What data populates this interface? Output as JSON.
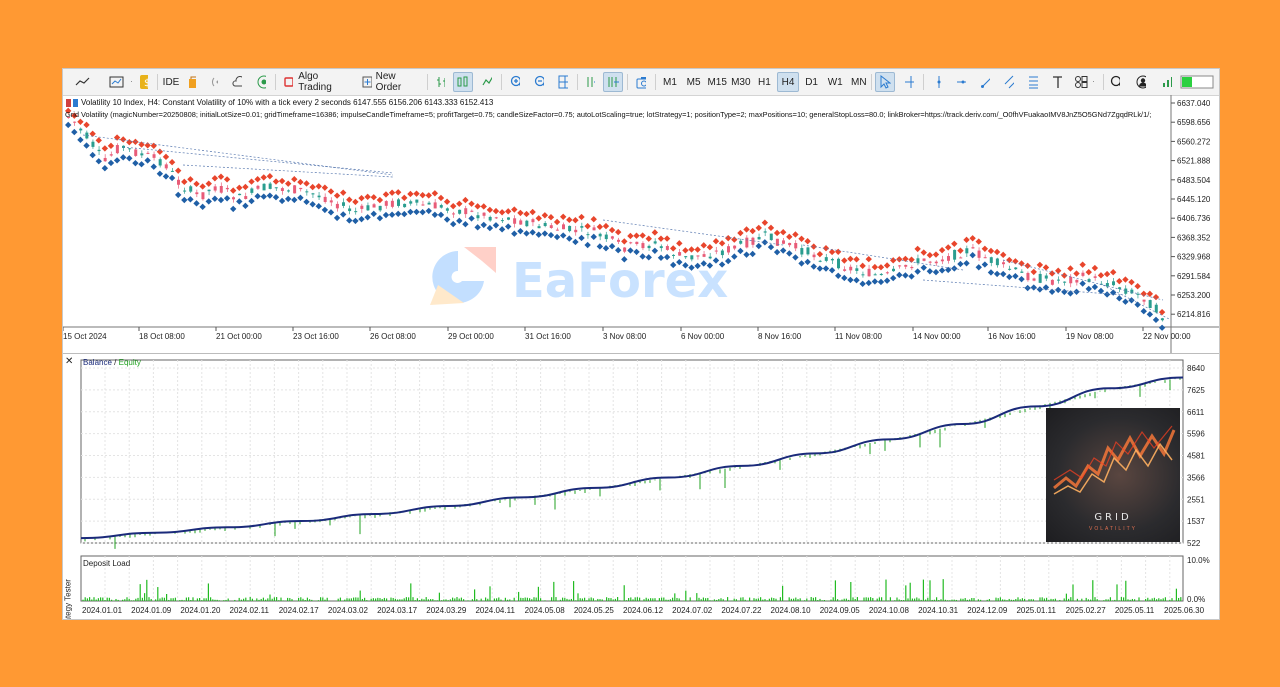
{
  "toolbar": {
    "ide_label": "IDE",
    "algo_trading_label": "Algo Trading",
    "new_order_label": "New Order",
    "timeframes": [
      "M1",
      "M5",
      "M15",
      "M30",
      "H1",
      "H4",
      "D1",
      "W1",
      "MN"
    ],
    "active_timeframe": "H4"
  },
  "chart": {
    "header": "Volatility 10 Index, H4:  Constant Volatility of 10% with a tick every 2 seconds  6147.555 6156.206 6143.333 6152.413",
    "params": "Grid Volatility (magicNumber=20250808; initialLotSize=0.01; gridTimeframe=16386; impulseCandleTimeframe=5; profitTarget=0.75; candleSizeFactor=0.75; autoLotScaling=true; lotStrategy=1; positionType=2; maxPositions=10; generalStopLoss=80.0; linkBroker=https://track.deriv.com/_O0fhVFuakaoIMV8JnZ5O5GNd7ZgqdRLk/1/;",
    "price_labels": [
      "6637.040",
      "6598.656",
      "6560.272",
      "6521.888",
      "6483.504",
      "6445.120",
      "6406.736",
      "6368.352",
      "6329.968",
      "6291.584",
      "6253.200",
      "6214.816"
    ],
    "date_labels": [
      "15 Oct 2024",
      "18 Oct 08:00",
      "21 Oct 00:00",
      "23 Oct 16:00",
      "26 Oct 08:00",
      "29 Oct 00:00",
      "31 Oct 16:00",
      "3 Nov 08:00",
      "6 Nov 00:00",
      "8 Nov 16:00",
      "11 Nov 08:00",
      "14 Nov 00:00",
      "16 Nov 16:00",
      "19 Nov 08:00",
      "22 Nov 00:00"
    ],
    "colors": {
      "bull": "#2a9d8f",
      "bear": "#e85c78",
      "sell_marker": "#e8452c",
      "buy_marker": "#1f5fa6"
    }
  },
  "chart_data": [
    {
      "type": "line",
      "series": [
        {
          "name": "Balance",
          "values": [
            750,
            1000,
            1250,
            1540,
            1870,
            2240,
            2640,
            3080,
            3560,
            4100,
            4680,
            5330,
            6040,
            6860,
            7700,
            8200
          ]
        },
        {
          "name": "Equity",
          "values": []
        }
      ],
      "x": [
        "2024.01.01",
        "2024.01.20",
        "2024.02.17",
        "2024.03.17",
        "2024.04.11",
        "2024.05.08",
        "2024.06.12",
        "2024.07.02",
        "2024.07.22",
        "2024.08.10",
        "2024.09.05",
        "2024.10.08",
        "2024.12.09",
        "2025.01.11",
        "2025.05.11",
        "2025.06.30"
      ],
      "ylim": [
        522,
        8640
      ],
      "y_ticks": [
        "8640",
        "7625",
        "6611",
        "5596",
        "4581",
        "3566",
        "2551",
        "1537",
        "522"
      ],
      "x_ticks": [
        "2024.01.01",
        "2024.01.09",
        "2024.01.20",
        "2024.02.11",
        "2024.02.17",
        "2024.03.02",
        "2024.03.17",
        "2024.03.29",
        "2024.04.11",
        "2024.05.08",
        "2024.05.25",
        "2024.06.12",
        "2024.07.02",
        "2024.07.22",
        "2024.08.10",
        "2024.09.05",
        "2024.10.08",
        "2024.10.31",
        "2024.12.09",
        "2025.01.11",
        "2025.02.27",
        "2025.05.11",
        "2025.06.30"
      ]
    },
    {
      "type": "bar",
      "title": "Deposit Load",
      "ylim": [
        0,
        10
      ],
      "y_ticks": [
        "10.0%",
        "0.0%"
      ]
    }
  ],
  "tester": {
    "balance_label": "Balance",
    "slash": "/",
    "equity_label": "Equity",
    "deposit_label": "Deposit Load",
    "side_label": "ategy Tester",
    "close_glyph": "✕",
    "colors": {
      "balance": "#1a2a7a",
      "equity": "#20a020",
      "deposit": "#22bb22"
    }
  },
  "watermark": {
    "text": "EaForex"
  },
  "thumbnail": {
    "title": "GRID",
    "subtitle": "VOLATILITY"
  }
}
